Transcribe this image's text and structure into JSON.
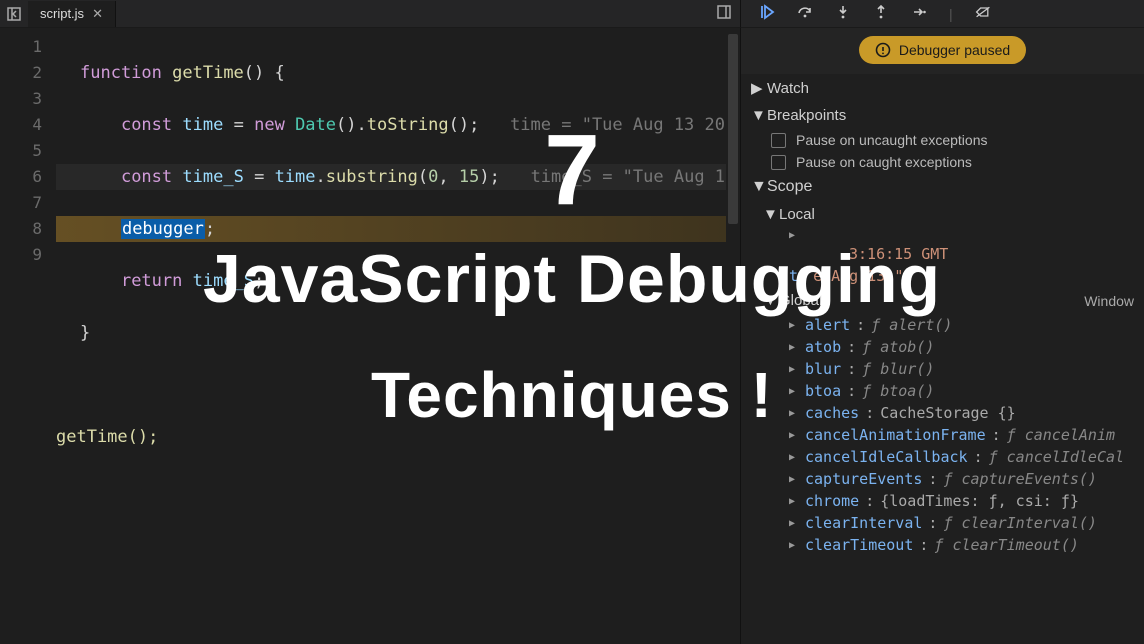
{
  "tab": {
    "filename": "script.js"
  },
  "editor": {
    "lines": [
      "1",
      "2",
      "3",
      "4",
      "5",
      "6",
      "7",
      "8",
      "9"
    ],
    "hint2": "time = \"Tue Aug 13 20",
    "hint3": "time_S = \"Tue Aug 1",
    "tokens": {
      "function": "function",
      "getTime": "getTime",
      "const": "const",
      "time": "time",
      "new": "new",
      "Date": "Date",
      "toString": "toString",
      "time_S": "time_S",
      "substring": "substring",
      "num0": "0",
      "num15": "15",
      "debugger": "debugger",
      "return": "return",
      "call": "getTime();"
    }
  },
  "debugger": {
    "paused": "Debugger paused",
    "watch": "Watch",
    "breakpoints": "Breakpoints",
    "pause_uncaught": "Pause on uncaught exceptions",
    "pause_caught": "Pause on caught exceptions",
    "scope": "Scope",
    "local": "Local",
    "local_time_suffix": "3:16:15 GMT",
    "local_timeS_suffix": "e Aug 13   \"",
    "global": "Global",
    "global_obj": "Window",
    "props": [
      {
        "name": "alert",
        "val": "ƒ alert()"
      },
      {
        "name": "atob",
        "val": "ƒ atob()"
      },
      {
        "name": "blur",
        "val": "ƒ blur()"
      },
      {
        "name": "btoa",
        "val": "ƒ btoa()"
      },
      {
        "name": "caches",
        "val": "CacheStorage {}"
      },
      {
        "name": "cancelAnimationFrame",
        "val": "ƒ cancelAnim"
      },
      {
        "name": "cancelIdleCallback",
        "val": "ƒ cancelIdleCal"
      },
      {
        "name": "captureEvents",
        "val": "ƒ captureEvents()"
      },
      {
        "name": "chrome",
        "val": "{loadTimes: ƒ, csi: ƒ}"
      },
      {
        "name": "clearInterval",
        "val": "ƒ clearInterval()"
      },
      {
        "name": "clearTimeout",
        "val": "ƒ clearTimeout()"
      }
    ]
  },
  "overlay": {
    "number": "7",
    "line1": "JavaScript Debugging",
    "line2": "Techniques !"
  }
}
